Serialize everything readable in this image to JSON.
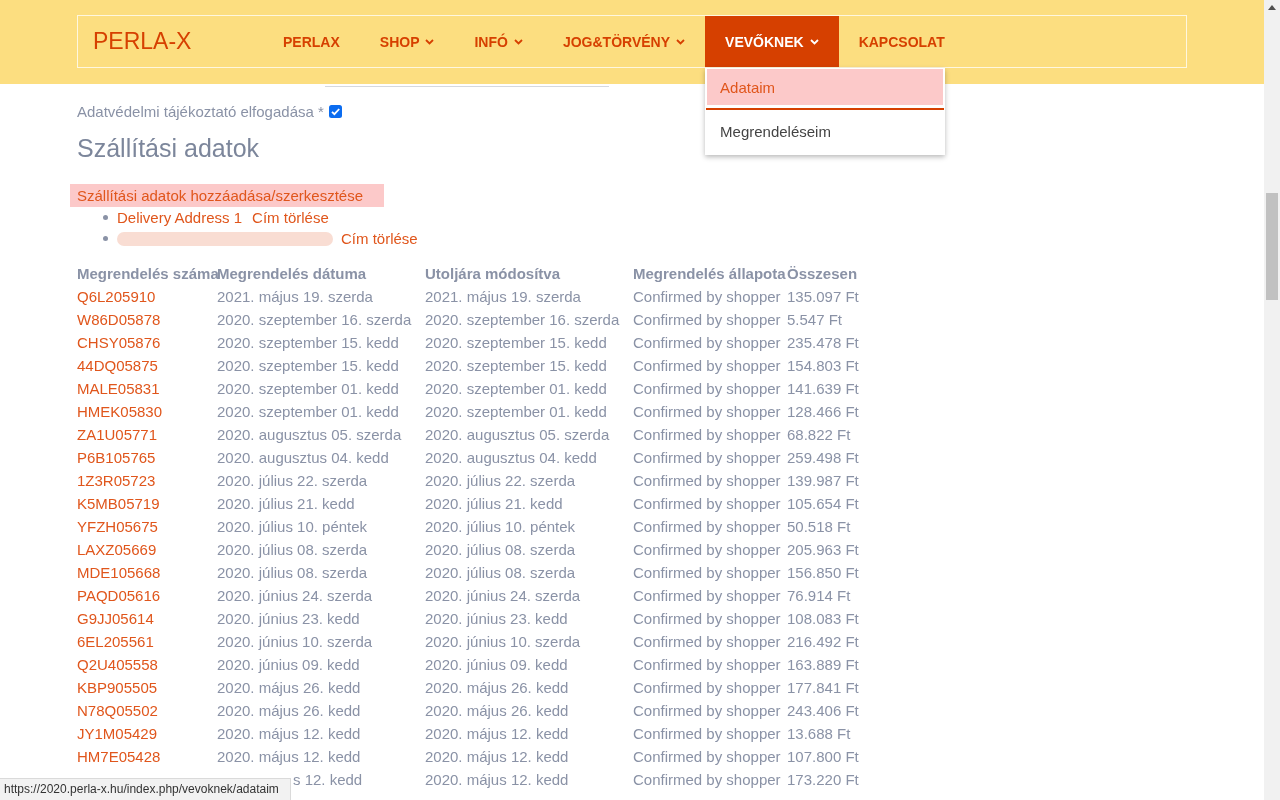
{
  "header": {
    "logo": "PERLA-X",
    "nav": [
      {
        "label": "PERLAX",
        "dropdown": false,
        "selected": false
      },
      {
        "label": "SHOP",
        "dropdown": true,
        "selected": false
      },
      {
        "label": "INFÓ",
        "dropdown": true,
        "selected": false
      },
      {
        "label": "JOG&TÖRVÉNY",
        "dropdown": true,
        "selected": false
      },
      {
        "label": "VEVŐKNEK",
        "dropdown": true,
        "selected": true,
        "menu": [
          {
            "label": "Adataim",
            "selected": true
          },
          {
            "label": "Megrendeléseim",
            "selected": false
          }
        ]
      },
      {
        "label": "KAPCSOLAT",
        "dropdown": false,
        "selected": false
      }
    ]
  },
  "form": {
    "privacy": {
      "label": "Adatvédelmi tájékoztató elfogadása *",
      "checked": true
    }
  },
  "shipping": {
    "title": "Szállítási adatok",
    "edit_link": "Szállítási adatok hozzáadása/szerkesztése",
    "addresses": [
      {
        "kind": "text",
        "label": "Delivery Address 1",
        "action": "Cím törlése"
      },
      {
        "kind": "redacted",
        "action": "Cím törlése"
      }
    ]
  },
  "orders": {
    "columns": [
      "Megrendelés száma",
      "Megrendelés dátuma",
      "Utoljára módosítva",
      "Megrendelés állapota",
      "Összesen"
    ],
    "rows": [
      {
        "order_no": "Q6L205910",
        "date": "2021. május 19. szerda",
        "modified": "2021. május 19. szerda",
        "status": "Confirmed by shopper",
        "total": "135.097 Ft"
      },
      {
        "order_no": "W86D05878",
        "date": "2020. szeptember 16. szerda",
        "modified": "2020. szeptember 16. szerda",
        "status": "Confirmed by shopper",
        "total": "5.547 Ft"
      },
      {
        "order_no": "CHSY05876",
        "date": "2020. szeptember 15. kedd",
        "modified": "2020. szeptember 15. kedd",
        "status": "Confirmed by shopper",
        "total": "235.478 Ft"
      },
      {
        "order_no": "44DQ05875",
        "date": "2020. szeptember 15. kedd",
        "modified": "2020. szeptember 15. kedd",
        "status": "Confirmed by shopper",
        "total": "154.803 Ft"
      },
      {
        "order_no": "MALE05831",
        "date": "2020. szeptember 01. kedd",
        "modified": "2020. szeptember 01. kedd",
        "status": "Confirmed by shopper",
        "total": "141.639 Ft"
      },
      {
        "order_no": "HMEK05830",
        "date": "2020. szeptember 01. kedd",
        "modified": "2020. szeptember 01. kedd",
        "status": "Confirmed by shopper",
        "total": "128.466 Ft"
      },
      {
        "order_no": "ZA1U05771",
        "date": "2020. augusztus 05. szerda",
        "modified": "2020. augusztus 05. szerda",
        "status": "Confirmed by shopper",
        "total": "68.822 Ft"
      },
      {
        "order_no": "P6B105765",
        "date": "2020. augusztus 04. kedd",
        "modified": "2020. augusztus 04. kedd",
        "status": "Confirmed by shopper",
        "total": "259.498 Ft"
      },
      {
        "order_no": "1Z3R05723",
        "date": "2020. július 22. szerda",
        "modified": "2020. július 22. szerda",
        "status": "Confirmed by shopper",
        "total": "139.987 Ft"
      },
      {
        "order_no": "K5MB05719",
        "date": "2020. július 21. kedd",
        "modified": "2020. július 21. kedd",
        "status": "Confirmed by shopper",
        "total": "105.654 Ft"
      },
      {
        "order_no": "YFZH05675",
        "date": "2020. július 10. péntek",
        "modified": "2020. július 10. péntek",
        "status": "Confirmed by shopper",
        "total": "50.518 Ft"
      },
      {
        "order_no": "LAXZ05669",
        "date": "2020. július 08. szerda",
        "modified": "2020. július 08. szerda",
        "status": "Confirmed by shopper",
        "total": "205.963 Ft"
      },
      {
        "order_no": "MDE105668",
        "date": "2020. július 08. szerda",
        "modified": "2020. július 08. szerda",
        "status": "Confirmed by shopper",
        "total": "156.850 Ft"
      },
      {
        "order_no": "PAQD05616",
        "date": "2020. június 24. szerda",
        "modified": "2020. június 24. szerda",
        "status": "Confirmed by shopper",
        "total": "76.914 Ft"
      },
      {
        "order_no": "G9JJ05614",
        "date": "2020. június 23. kedd",
        "modified": "2020. június 23. kedd",
        "status": "Confirmed by shopper",
        "total": "108.083 Ft"
      },
      {
        "order_no": "6EL205561",
        "date": "2020. június 10. szerda",
        "modified": "2020. június 10. szerda",
        "status": "Confirmed by shopper",
        "total": "216.492 Ft"
      },
      {
        "order_no": "Q2U405558",
        "date": "2020. június 09. kedd",
        "modified": "2020. június 09. kedd",
        "status": "Confirmed by shopper",
        "total": "163.889 Ft"
      },
      {
        "order_no": "KBP905505",
        "date": "2020. május 26. kedd",
        "modified": "2020. május 26. kedd",
        "status": "Confirmed by shopper",
        "total": "177.841 Ft"
      },
      {
        "order_no": "N78Q05502",
        "date": "2020. május 26. kedd",
        "modified": "2020. május 26. kedd",
        "status": "Confirmed by shopper",
        "total": "243.406 Ft"
      },
      {
        "order_no": "JY1M05429",
        "date": "2020. május 12. kedd",
        "modified": "2020. május 12. kedd",
        "status": "Confirmed by shopper",
        "total": "13.688 Ft"
      },
      {
        "order_no": "HM7E05428",
        "date": "2020. május 12. kedd",
        "modified": "2020. május 12. kedd",
        "status": "Confirmed by shopper",
        "total": "107.800 Ft"
      },
      {
        "covered_by_tooltip": true,
        "date": "s 12. kedd",
        "modified": "2020. május 12. kedd",
        "status": "Confirmed by shopper",
        "total": "173.220 Ft"
      }
    ]
  },
  "status_bar": {
    "url": "https://2020.perla-x.hu/index.php/vevoknek/adataim"
  }
}
